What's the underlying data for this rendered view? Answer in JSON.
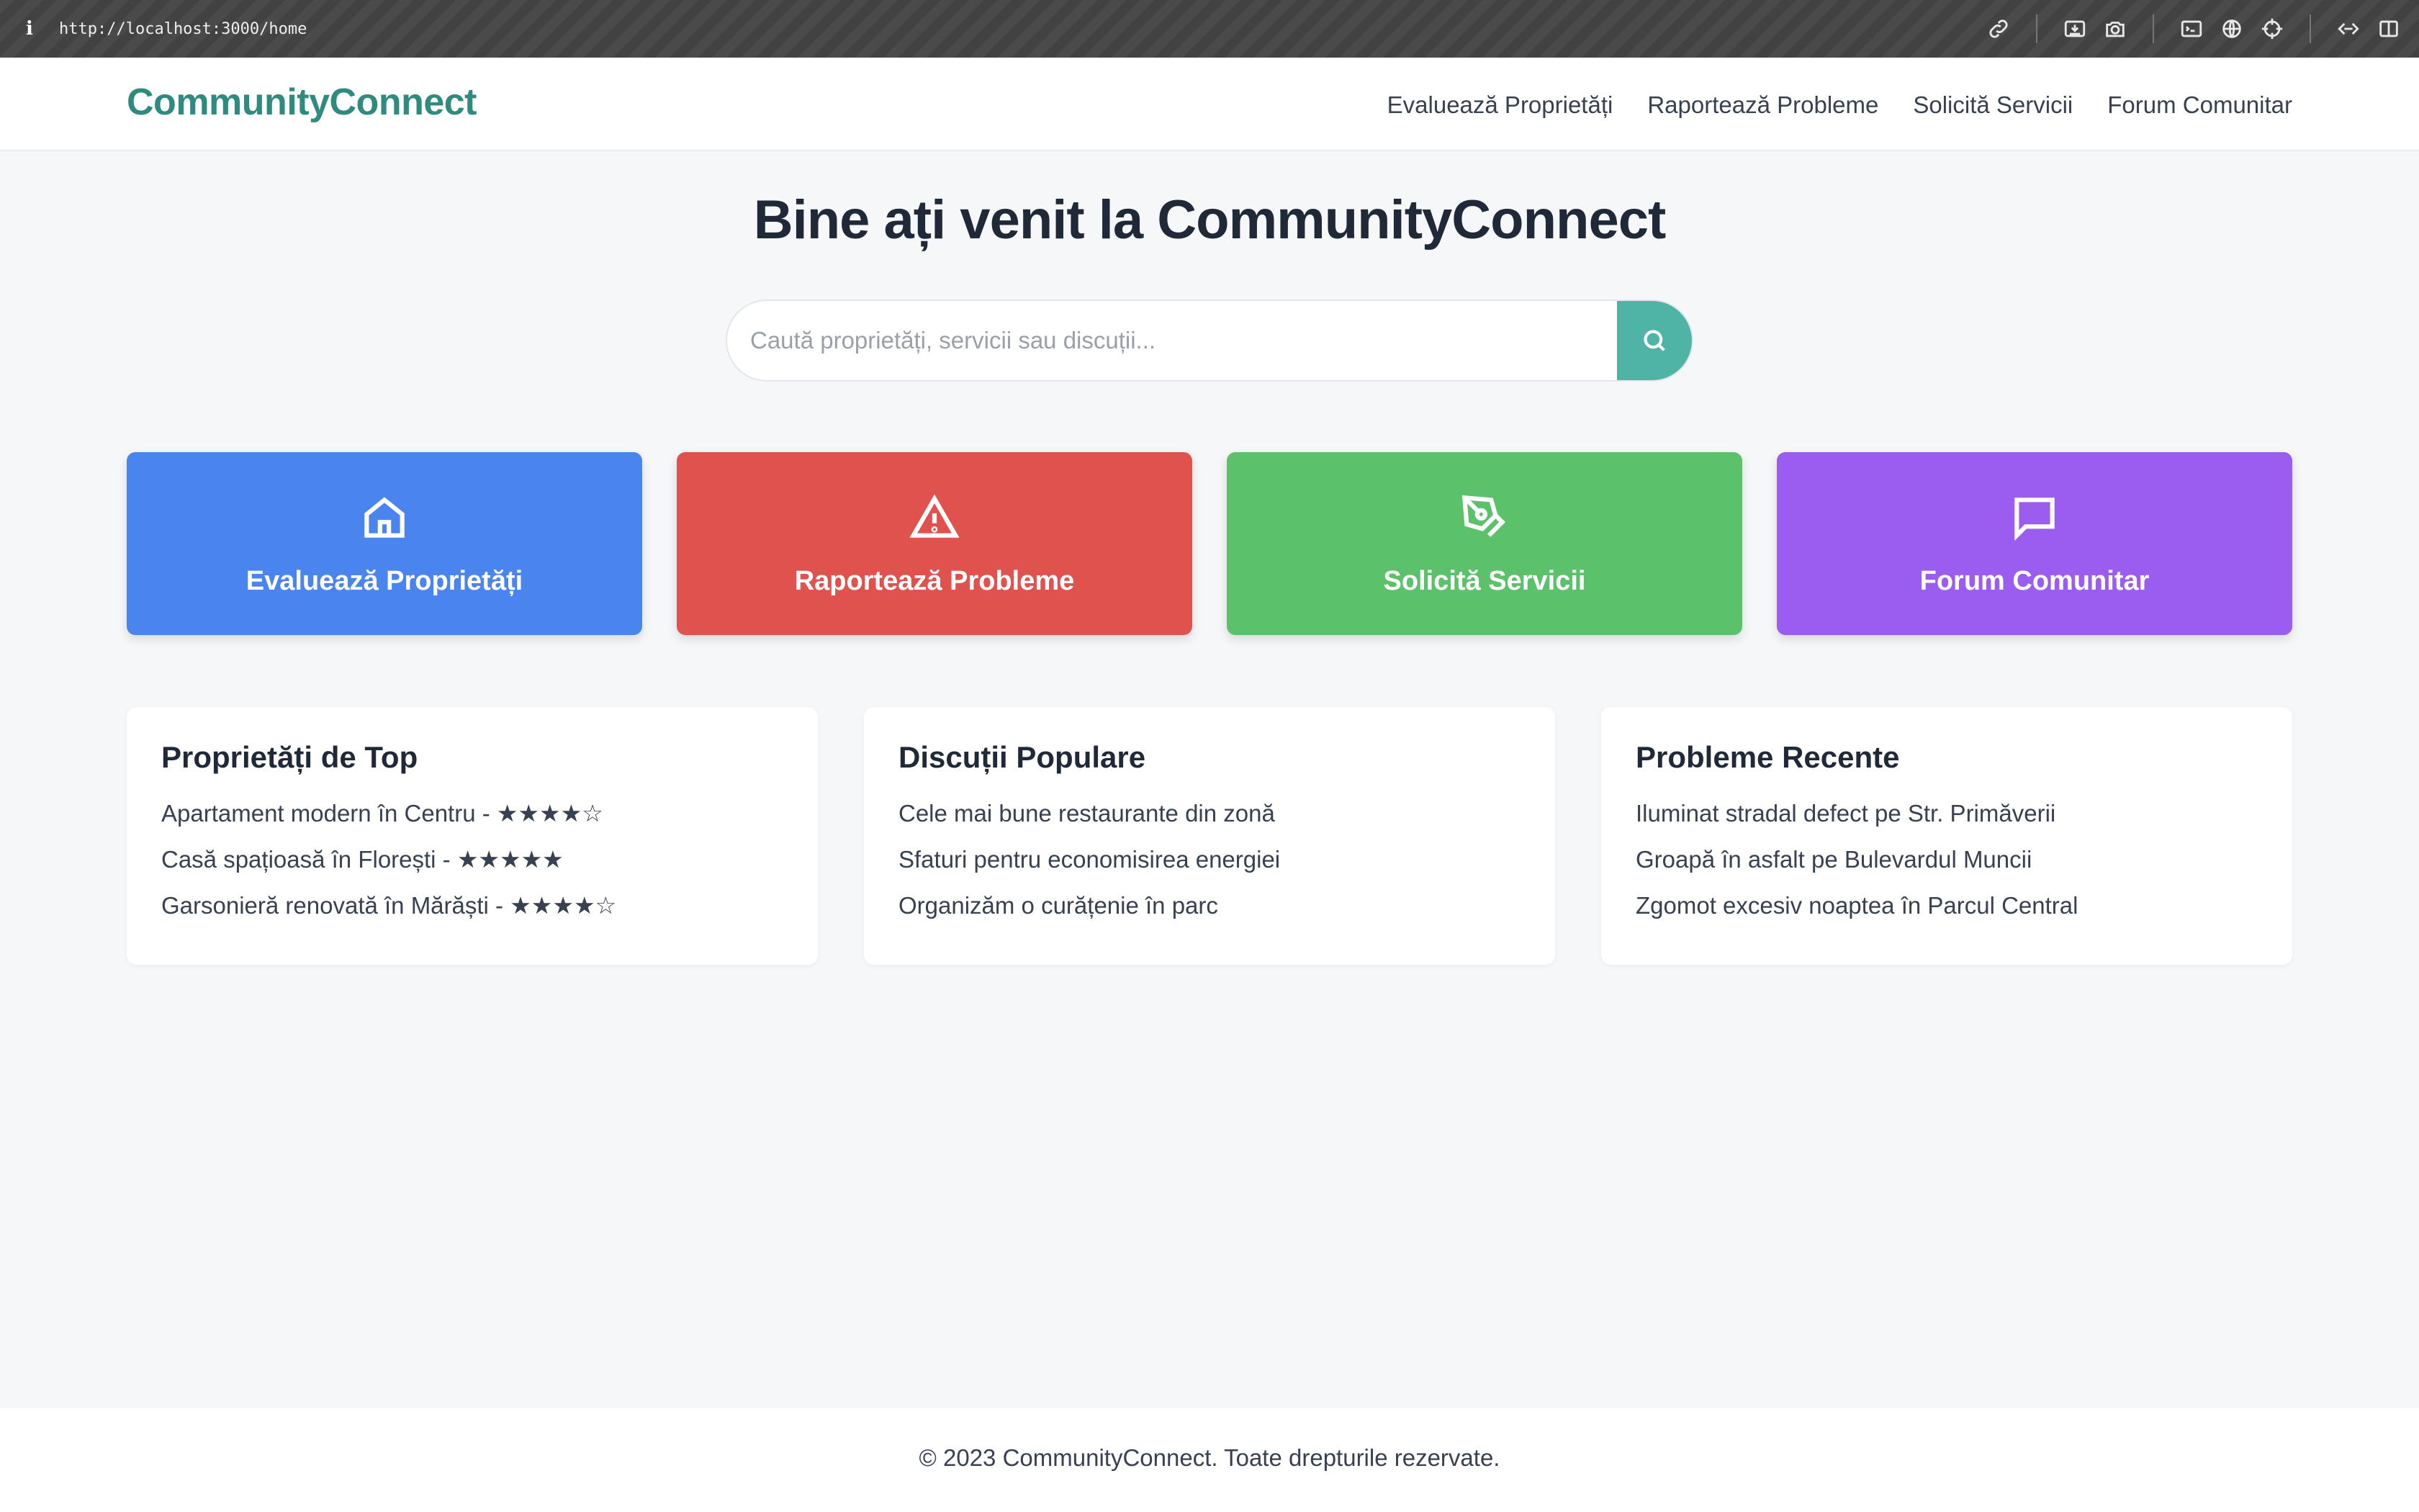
{
  "browser": {
    "info_glyph": "i",
    "url": "http://localhost:3000/home",
    "tools": [
      "link-icon",
      "install-icon",
      "camera-icon",
      "terminal-icon",
      "globe-icon",
      "crosshair-icon",
      "extensions-icon",
      "sidebar-icon"
    ]
  },
  "site": {
    "logo": "CommunityConnect",
    "nav": [
      "Evaluează Proprietăți",
      "Raportează Probleme",
      "Solicită Servicii",
      "Forum Comunitar"
    ]
  },
  "hero": {
    "title": "Bine ați venit la CommunityConnect",
    "search_placeholder": "Caută proprietăți, servicii sau discuții..."
  },
  "cards": [
    {
      "label": "Evaluează Proprietăți",
      "icon": "home-icon",
      "color": "#4a84ef"
    },
    {
      "label": "Raportează Probleme",
      "icon": "warning-icon",
      "color": "#e0524d"
    },
    {
      "label": "Solicită Servicii",
      "icon": "pen-tool-icon",
      "color": "#5bc26b"
    },
    {
      "label": "Forum Comunitar",
      "icon": "chat-icon",
      "color": "#9b5cf0"
    }
  ],
  "panels": [
    {
      "title": "Proprietăți de Top",
      "items": [
        "Apartament modern în Centru - ★★★★☆",
        "Casă spațioasă în Florești - ★★★★★",
        "Garsonieră renovată în Mărăști - ★★★★☆"
      ]
    },
    {
      "title": "Discuții Populare",
      "items": [
        "Cele mai bune restaurante din zonă",
        "Sfaturi pentru economisirea energiei",
        "Organizăm o curățenie în parc"
      ]
    },
    {
      "title": "Probleme Recente",
      "items": [
        "Iluminat stradal defect pe Str. Primăverii",
        "Groapă în asfalt pe Bulevardul Muncii",
        "Zgomot excesiv noaptea în Parcul Central"
      ]
    }
  ],
  "footer": {
    "text": "© 2023 CommunityConnect. Toate drepturile rezervate."
  },
  "colors": {
    "brand": "#2e8b7e",
    "search_button": "#4fb3a6",
    "page_background": "#f6f7f9"
  }
}
